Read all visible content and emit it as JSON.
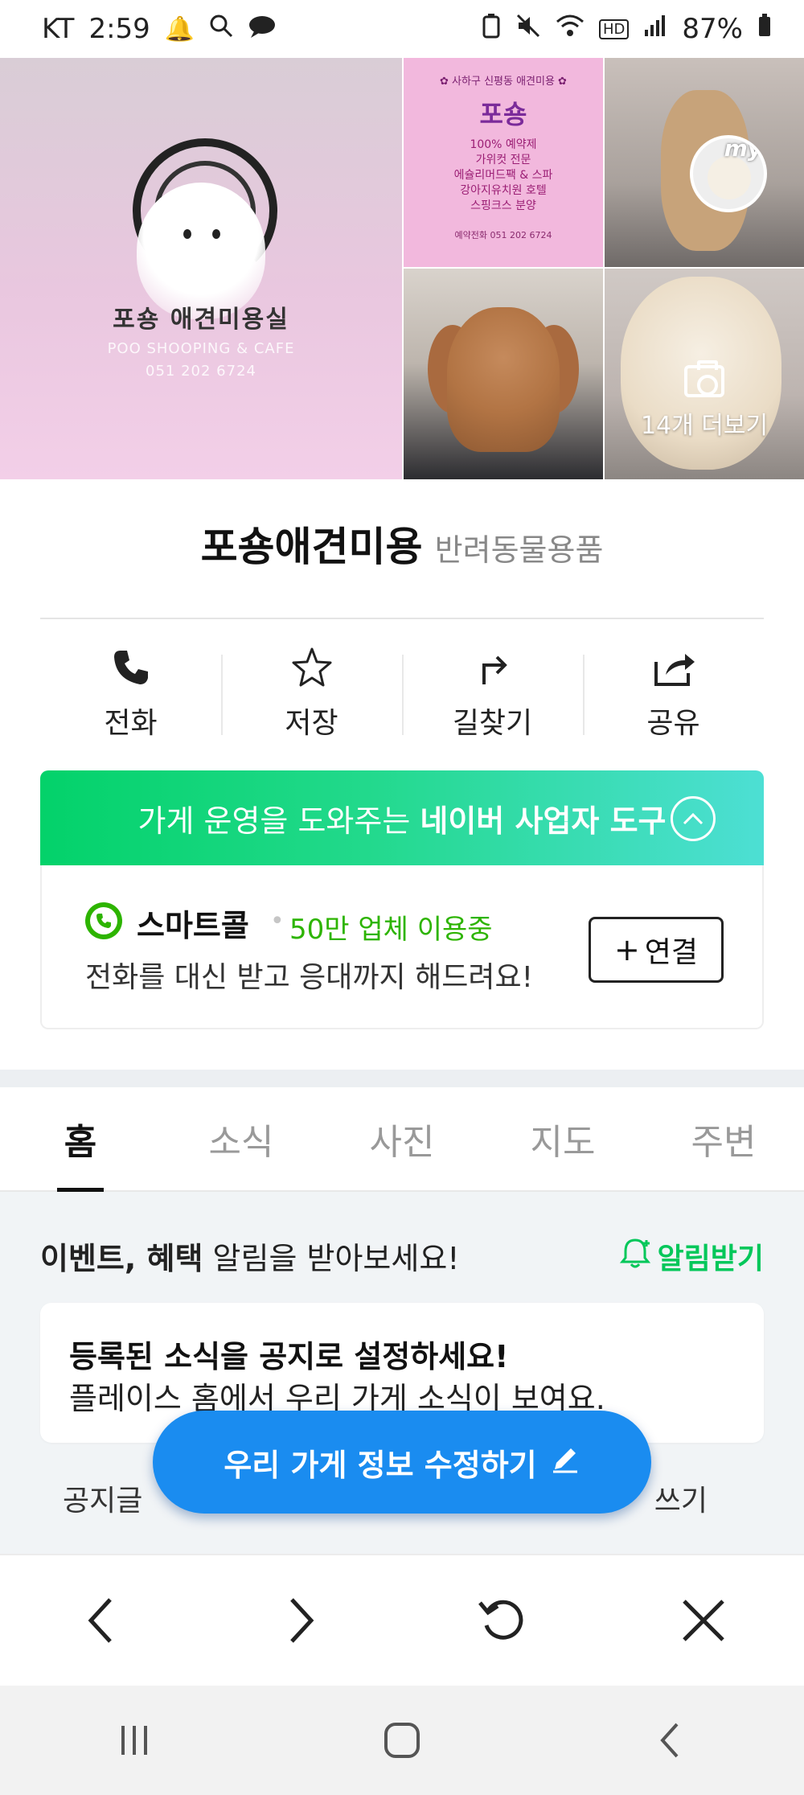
{
  "status_bar": {
    "carrier": "KT",
    "time": "2:59",
    "battery": "87%"
  },
  "gallery": {
    "logo_name": "포숑 애견미용실",
    "logo_sub_1": "POO SHOOPING & CAFE",
    "logo_sub_2": "051 202 6724",
    "poster": {
      "head": "✿ 사하구 신평동 애견미용 ✿",
      "title": "포숑",
      "lines": [
        "100% 예약제",
        "가위컷 전문",
        "에슐리머드팩 & 스파",
        "강아지유치원 호텔",
        "스핑크스 분양"
      ],
      "tel": "예약전화 051 202 6724"
    },
    "my_badge": "my",
    "more_label": "14개 더보기"
  },
  "place": {
    "name": "포숑애견미용",
    "category": "반려동물용품"
  },
  "actions": [
    {
      "label": "전화",
      "icon": "phone-icon"
    },
    {
      "label": "저장",
      "icon": "star-icon"
    },
    {
      "label": "길찾기",
      "icon": "directions-icon"
    },
    {
      "label": "공유",
      "icon": "share-icon"
    }
  ],
  "naver_banner": {
    "text_prefix": "가게 운영을 도와주는 ",
    "text_bold": "네이버 사업자 도구"
  },
  "smartcall": {
    "name": "스마트콜",
    "users": "50만 업체 이용중",
    "desc": "전화를 대신 받고 응대까지 해드려요!",
    "connect_label": "연결"
  },
  "tabs": [
    {
      "label": "홈",
      "active": true
    },
    {
      "label": "소식",
      "active": false
    },
    {
      "label": "사진",
      "active": false
    },
    {
      "label": "지도",
      "active": false
    },
    {
      "label": "주변",
      "active": false
    }
  ],
  "alarm": {
    "bold": "이벤트, 혜택",
    "rest": " 알림을 받아보세요!",
    "button": "알림받기"
  },
  "notice": {
    "title": "등록된 소식을 공지로 설정하세요!",
    "desc": "플레이스 홈에서 우리 가게 소식이 보여요.",
    "row_left": "공지글",
    "row_right": "쓰기"
  },
  "fab": {
    "label": "우리 가게 정보 수정하기"
  },
  "colors": {
    "naver_green": "#03c75a",
    "fab_blue": "#1a8cf0",
    "smartcall_green": "#2db400"
  }
}
